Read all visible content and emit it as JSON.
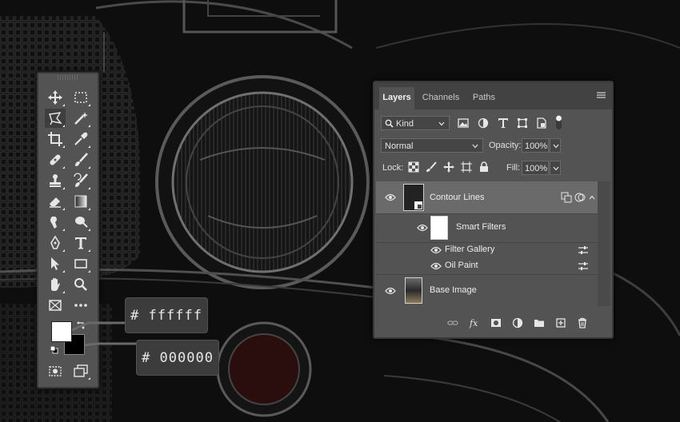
{
  "toolbar": {
    "tools": [
      {
        "name": "move-tool",
        "icon": "move-icon"
      },
      {
        "name": "marquee-tool",
        "icon": "rect-marquee-icon"
      },
      {
        "name": "polygonal-lasso-tool",
        "icon": "polygonal-lasso-icon",
        "active": true
      },
      {
        "name": "magic-wand-tool",
        "icon": "magic-wand-icon"
      },
      {
        "name": "crop-tool",
        "icon": "crop-icon"
      },
      {
        "name": "eyedropper-tool",
        "icon": "eyedropper-icon"
      },
      {
        "name": "healing-brush-tool",
        "icon": "band-aid-icon"
      },
      {
        "name": "brush-tool",
        "icon": "brush-icon"
      },
      {
        "name": "clone-stamp-tool",
        "icon": "stamp-icon"
      },
      {
        "name": "history-brush-tool",
        "icon": "history-brush-icon"
      },
      {
        "name": "eraser-tool",
        "icon": "eraser-icon"
      },
      {
        "name": "gradient-tool",
        "icon": "gradient-icon"
      },
      {
        "name": "smudge-tool",
        "icon": "smudge-icon"
      },
      {
        "name": "dodge-tool",
        "icon": "dodge-icon"
      },
      {
        "name": "pen-tool",
        "icon": "pen-icon"
      },
      {
        "name": "type-tool",
        "icon": "type-icon"
      },
      {
        "name": "path-selection-tool",
        "icon": "arrow-icon"
      },
      {
        "name": "rectangle-tool",
        "icon": "rectangle-icon"
      },
      {
        "name": "hand-tool",
        "icon": "hand-icon"
      },
      {
        "name": "zoom-tool",
        "icon": "zoom-icon"
      },
      {
        "name": "frame-tool",
        "icon": "frame-icon"
      },
      {
        "name": "more-tools",
        "icon": "ellipsis-icon"
      }
    ],
    "foreground_color": "#ffffff",
    "background_color": "#000000"
  },
  "callouts": {
    "foreground": "# ffffff",
    "background": "# 000000"
  },
  "layers_panel": {
    "tabs": [
      {
        "label": "Layers",
        "active": true
      },
      {
        "label": "Channels",
        "active": false
      },
      {
        "label": "Paths",
        "active": false
      }
    ],
    "filter_kind": "Kind",
    "blend_mode": "Normal",
    "opacity_label": "Opacity:",
    "opacity_value": "100%",
    "lock_label": "Lock:",
    "fill_label": "Fill:",
    "fill_value": "100%",
    "layers": [
      {
        "name": "Contour Lines",
        "selected": true
      },
      {
        "name": "Smart Filters",
        "selected": false
      },
      {
        "name": "Filter Gallery",
        "selected": false
      },
      {
        "name": "Oil Paint",
        "selected": false
      },
      {
        "name": "Base Image",
        "selected": false
      }
    ]
  }
}
